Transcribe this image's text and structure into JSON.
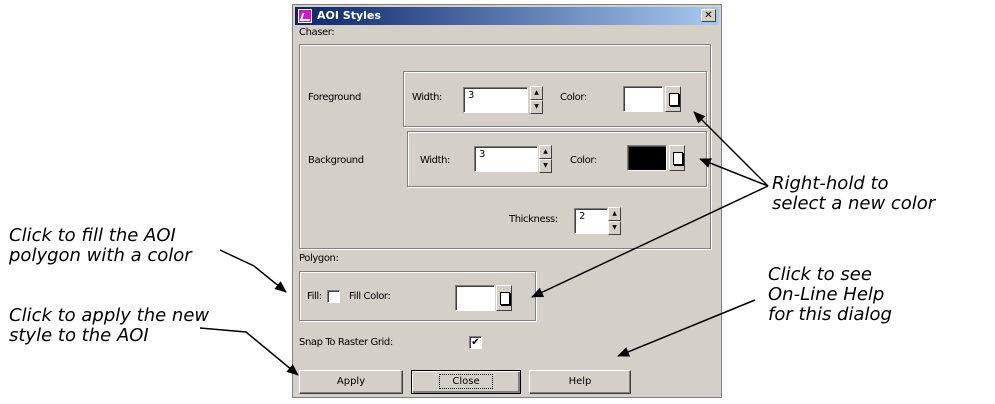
{
  "dialog": {
    "title": "AOI Styles",
    "close_glyph": "✕",
    "chaser_label": "Chaser:",
    "foreground": {
      "label": "Foreground",
      "width_label": "Width:",
      "width_value": "3",
      "color_label": "Color:",
      "color": "#ffffff"
    },
    "background": {
      "label": "Background",
      "width_label": "Width:",
      "width_value": "3",
      "color_label": "Color:",
      "color": "#000000"
    },
    "thickness_label": "Thickness:",
    "thickness_value": "2",
    "polygon_label": "Polygon:",
    "fill_label": "Fill:",
    "fill_checked": false,
    "fill_color_label": "Fill Color:",
    "fill_color": "#ffffff",
    "snap_label": "Snap To Raster Grid:",
    "snap_checked": true,
    "snap_glyph": "✔",
    "buttons": {
      "apply": "Apply",
      "close": "Close",
      "help": "Help"
    }
  },
  "annotations": {
    "fill_note": [
      "Click to fill the AOI",
      "polygon with a color"
    ],
    "apply_note": [
      "Click to apply the new",
      "style to the AOI"
    ],
    "color_note": [
      "Right-hold to",
      "select a new color"
    ],
    "help_note": [
      "Click to see",
      "On-Line Help",
      "for this dialog"
    ]
  },
  "colors": {
    "dialog_bg": "#d4d0c8",
    "titlebar_start": "#0a246a",
    "titlebar_end": "#a6caf0"
  }
}
